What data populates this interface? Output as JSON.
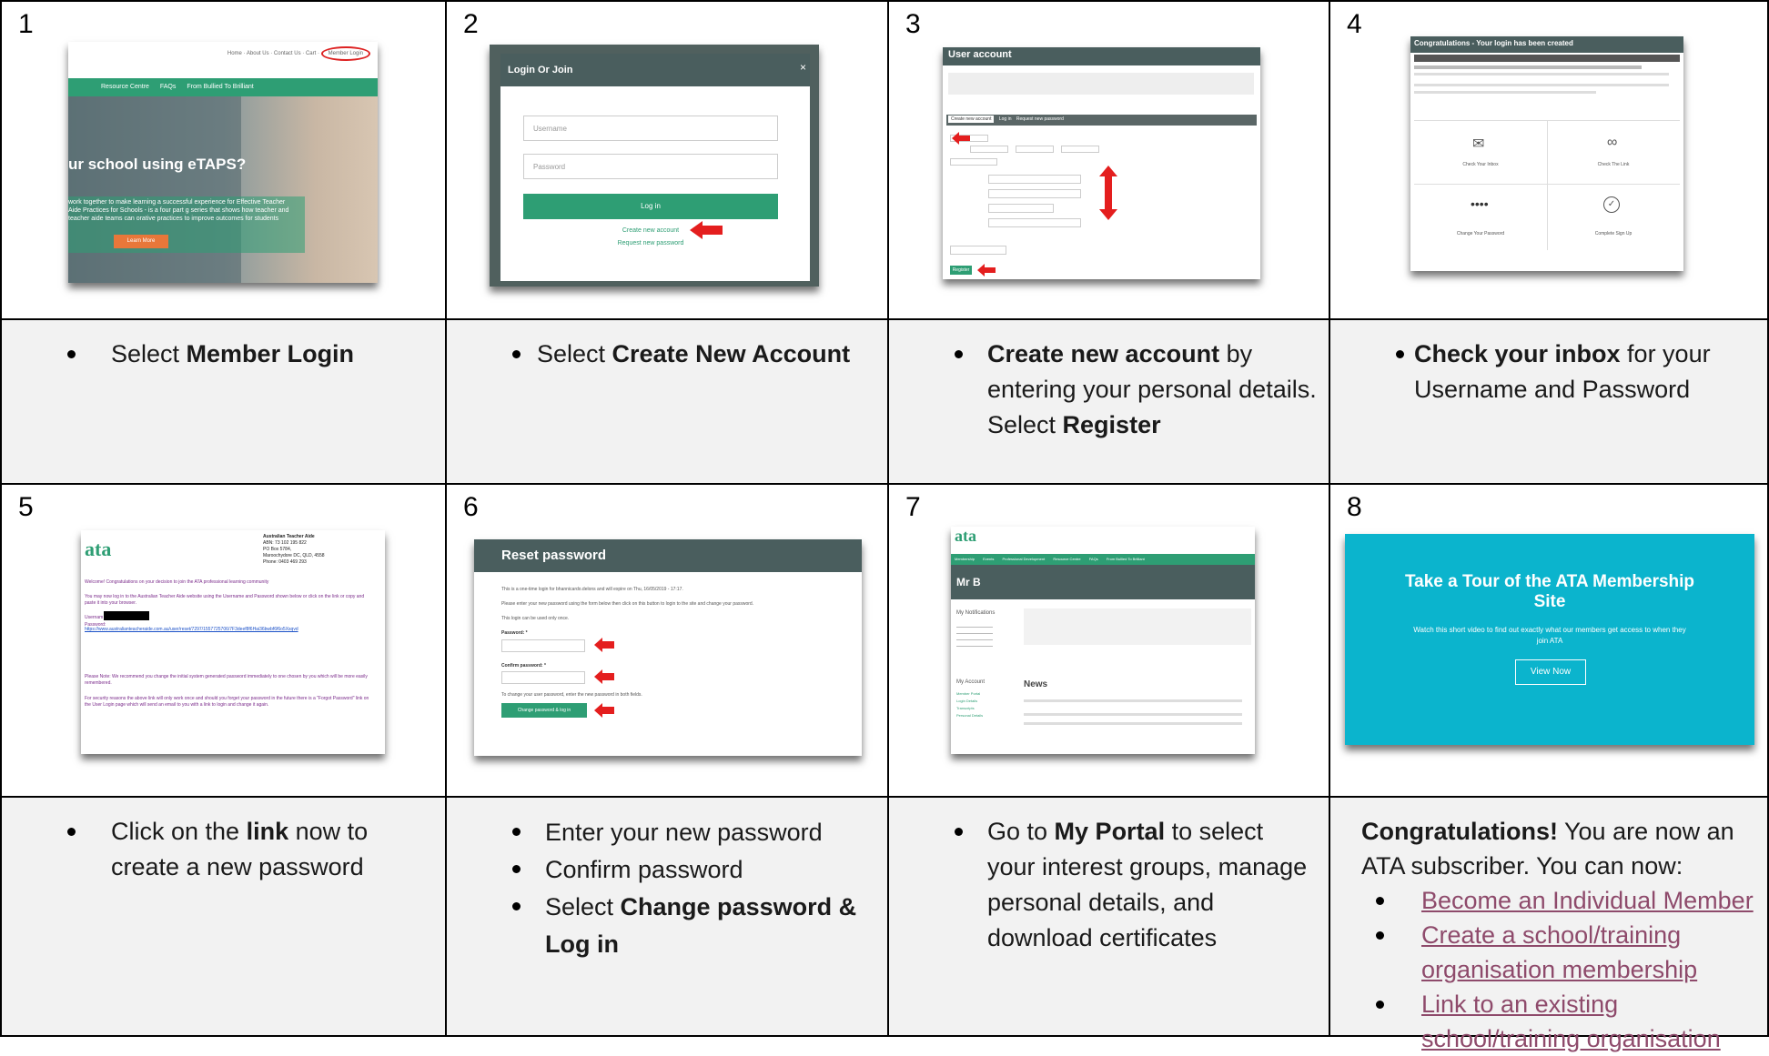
{
  "steps": [
    {
      "num": "1",
      "instructions": [
        {
          "pre": "Select ",
          "bold": "Member Login",
          "post": ""
        }
      ]
    },
    {
      "num": "2",
      "instructions": [
        {
          "pre": "Select ",
          "bold": "Create New Account",
          "post": ""
        }
      ]
    },
    {
      "num": "3",
      "instructions": [
        {
          "pre": "",
          "bold": "Create new account",
          "post": " by entering your personal details. Select ",
          "bold2": "Register"
        }
      ]
    },
    {
      "num": "4",
      "instructions": [
        {
          "pre": "",
          "bold": "Check your inbox",
          "post": " for your Username and Password"
        }
      ]
    },
    {
      "num": "5",
      "instructions": [
        {
          "pre": "Click on the ",
          "bold": "link",
          "post": " now to create a new password"
        }
      ]
    },
    {
      "num": "6",
      "instructions": [
        {
          "pre": "Enter your new password",
          "bold": "",
          "post": ""
        },
        {
          "pre": "Confirm password",
          "bold": "",
          "post": ""
        },
        {
          "pre": "Select ",
          "bold": "Change password & Log in",
          "post": ""
        }
      ]
    },
    {
      "num": "7",
      "instructions": [
        {
          "pre": "Go to ",
          "bold": "My Portal",
          "post": " to select your interest groups, manage personal details, and download certificates"
        }
      ]
    },
    {
      "num": "8",
      "congrats_bold": "Congratulations!",
      "congrats_text": " You are now an ATA subscriber. You can now:",
      "links": [
        "Become an Individual Member",
        "Create a school/training organisation membership",
        "Link to an existing school/training organisation"
      ]
    }
  ],
  "shots": {
    "s1": {
      "nav": [
        "Home",
        "About Us",
        "Contact Us",
        "Cart",
        "Member Login"
      ],
      "menu": [
        "Resource Centre",
        "FAQs",
        "From Bullied To Brilliant"
      ],
      "headline": "ur school using eTAPS?",
      "body": "work together to make learning a successful experience for Effective Teacher Aide Practices for Schools - is a four part g series that shows how teacher and teacher aide teams can orative practices to improve outcomes for students",
      "button": "Learn More"
    },
    "s2": {
      "title": "Login Or Join",
      "username": "Username",
      "password": "Password",
      "login": "Log in",
      "create": "Create new account",
      "request": "Request new password"
    },
    "s3": {
      "title": "User account",
      "tabs": [
        "Create new account",
        "Log in",
        "Request new password"
      ],
      "register": "Register"
    },
    "s4": {
      "title": "Congratulations - Your login has been created",
      "cards": [
        "Check Your Inbox",
        "Check The Link",
        "Change Your Password",
        "Complete Sign Up"
      ]
    },
    "s5": {
      "org": "Australian Teacher Aide",
      "abn": "ABN: 73 102 195 822",
      "addr1": "PO Box 5784,",
      "addr2": "Maroochydore DC, QLD, 4558",
      "phone": "Phone: 0403 469 293",
      "welcome": "Welcome! Congratulations on your decision to join the ATA professional learning community",
      "line2": "You may now log in to the Australian Teacher Aide website using the Username and Password shown below or click on the link or copy and paste it into your browser.",
      "username": "Username:",
      "password": "Password:",
      "link": "https://www.australianteacheraide.com.au/user/reset/7297/1557725706/7F3deef8f6Hai36bwbf6f6o5Xsqvd",
      "note": "Please Note: We recommend you change the initial system generated password immediately to one chosen by you which will be more easily remembered.",
      "sec": "For security reasons the above link will only work once and should you forget your password in the future there is a \"Forgot Password\" link on the User Login page which will send an email to you with a link to login and change it again."
    },
    "s6": {
      "title": "Reset password",
      "l1": "This is a one-time login for bhannicardo.delons and will expire on Thu, 16/05/2019 - 17:17.",
      "l2": "Please enter your new password using the form below then click on this button to login to the site and change your password.",
      "l3": "This login can be used only once.",
      "pw": "Password: *",
      "cpw": "Confirm password: *",
      "hint": "To change your user password, enter the new password in both fields.",
      "button": "Change password & log in"
    },
    "s7": {
      "name": "Mr B",
      "menu": [
        "Membership",
        "Events",
        "Professional Development",
        "Resource Centre",
        "FAQs",
        "From Bullied To Brilliant"
      ],
      "notif": "My Notifications",
      "account": "My Account",
      "news": "News",
      "links": [
        "Member Portal",
        "Login Details",
        "Transcripts",
        "Personal Details"
      ]
    },
    "s8": {
      "title": "Take a Tour of the ATA Membership Site",
      "body": "Watch this short video to find out exactly what our members get access to when they join ATA",
      "button": "View Now"
    }
  },
  "colors": {
    "accent_green": "#2e9e74",
    "dark_header": "#4a5e5e",
    "teal": "#00b5cc",
    "link_purple": "#8e4a6b",
    "red_arrow": "#e41e1e"
  }
}
